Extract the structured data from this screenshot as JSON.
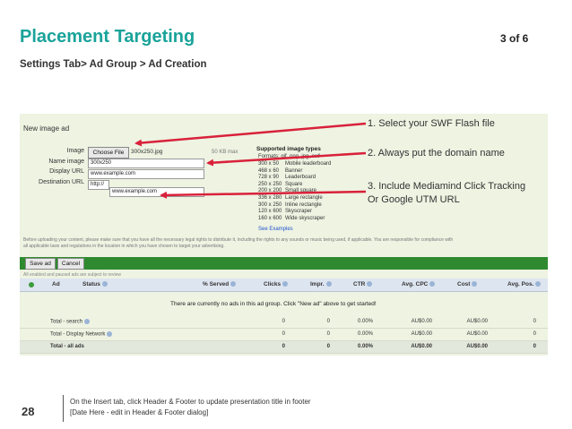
{
  "slide": {
    "title": "Placement Targeting",
    "page_indicator": "3 of 6",
    "breadcrumb": "Settings Tab> Ad Group > Ad Creation",
    "slide_number": "28",
    "footer_line1": "On the Insert tab, click Header & Footer to update presentation title in footer",
    "footer_line2": "[Date Here - edit in Header & Footer dialog]"
  },
  "form": {
    "heading": "New image ad",
    "image_label": "Image",
    "choose_file_button": "Choose File",
    "file_name": "300x250.jpg",
    "max_size": "50 KB max",
    "name_label": "Name image",
    "name_value": "300x250",
    "display_url_label": "Display URL",
    "display_url_value": "www.example.com",
    "destination_url_label": "Destination URL",
    "protocol_value": "http://",
    "destination_url_value": "www.example.com",
    "supported_title": "Supported image types",
    "supported_formats": "Formats: gif, png, jpg, swf",
    "sizes": [
      {
        "size": "300 x 50",
        "name": "Mobile leaderboard"
      },
      {
        "size": "468 x 60",
        "name": "Banner"
      },
      {
        "size": "728 x 90",
        "name": "Leaderboard"
      },
      {
        "size": "250 x 250",
        "name": "Square"
      },
      {
        "size": "200 x 200",
        "name": "Small square"
      },
      {
        "size": "336 x 280",
        "name": "Large rectangle"
      },
      {
        "size": "300 x 250",
        "name": "Inline rectangle"
      },
      {
        "size": "120 x 600",
        "name": "Skyscraper"
      },
      {
        "size": "160 x 600",
        "name": "Wide skyscraper"
      }
    ],
    "see_examples": "See Examples",
    "disclaimer_1": "Before uploading your content, please make sure that you have all the necessary legal rights to distribute it, including the rights to any sounds or music being used, if applicable. You are responsible for compliance with",
    "disclaimer_2": "all applicable laws and regulations in the location in which you have chosen to target your advertising.",
    "save_button": "Save ad",
    "cancel_button": "Cancel"
  },
  "table": {
    "filter_text": "All enabled and paused ads are subject to review",
    "headers": [
      "Ad",
      "Status",
      "% Served",
      "Clicks",
      "Impr.",
      "CTR",
      "Avg. CPC",
      "Cost",
      "Avg. Pos."
    ],
    "empty_message": "There are currently no ads in this ad group. Click \"New ad\" above to get started!",
    "totals": [
      {
        "label": "Total - search",
        "clicks": "0",
        "impr": "0",
        "ctr": "0.00%",
        "cpc": "AU$0.00",
        "cost": "AU$0.00",
        "pos": "0"
      },
      {
        "label": "Total - Display Network",
        "clicks": "0",
        "impr": "0",
        "ctr": "0.00%",
        "cpc": "AU$0.00",
        "cost": "AU$0.00",
        "pos": "0"
      },
      {
        "label": "Total - all ads",
        "clicks": "0",
        "impr": "0",
        "ctr": "0.00%",
        "cpc": "AU$0.00",
        "cost": "AU$0.00",
        "pos": "0"
      }
    ]
  },
  "callouts": {
    "c1": "1. Select your SWF Flash file",
    "c2": "2. Always put the domain name",
    "c3_line1": "3. Include Mediamind Click Tracking",
    "c3_line2": "Or Google UTM URL"
  },
  "colors": {
    "title_teal": "#1aa39a",
    "arrow_red": "#d9213a",
    "adwords_green": "#2f8a2f",
    "panel_bg": "#eef3e2"
  }
}
